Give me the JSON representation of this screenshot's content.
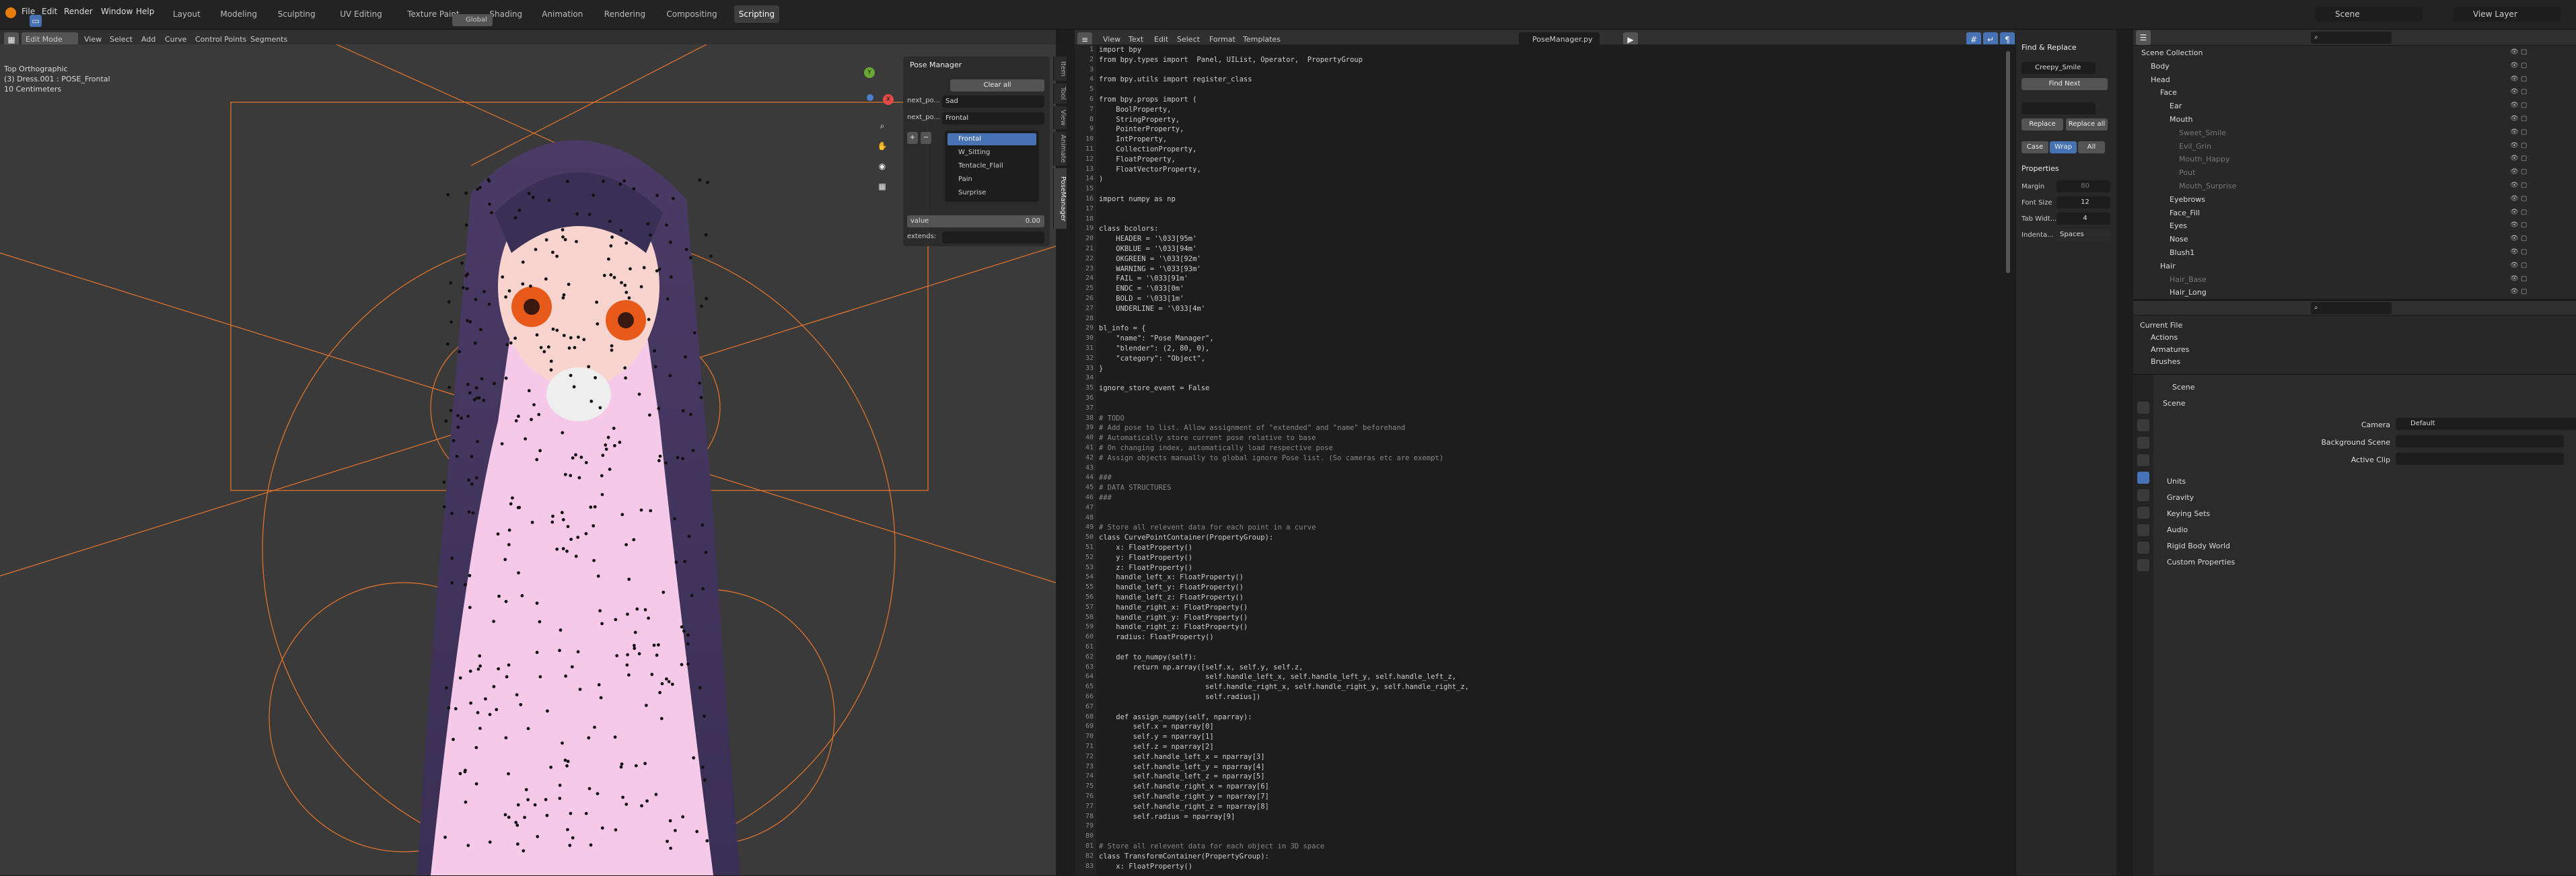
{
  "menu": {
    "file": "File",
    "edit": "Edit",
    "render": "Render",
    "window": "Window",
    "help": "Help"
  },
  "workspaces": [
    "Layout",
    "Modeling",
    "Sculpting",
    "UV Editing",
    "Texture Paint",
    "Shading",
    "Animation",
    "Rendering",
    "Compositing",
    "Scripting"
  ],
  "active_workspace": "Scripting",
  "scene": {
    "name": "Scene",
    "view_layer": "View Layer"
  },
  "viewport": {
    "header": {
      "mode": "Edit Mode",
      "view": "View",
      "select": "Select",
      "add": "Add",
      "curve": "Curve",
      "control_points": "Control Points",
      "segments": "Segments",
      "orientation": "Global"
    },
    "info_line1": "Top Orthographic",
    "info_line2": "(3) Dress.001 : POSE_Frontal",
    "info_line3": "10 Centimeters",
    "gizmo": {
      "x": "X",
      "y": "Y",
      "z": "Z"
    }
  },
  "pose_panel": {
    "title": "Pose Manager",
    "clear_all": "Clear all",
    "next_pose_label": "next_po...",
    "next_pose_value": "Sad",
    "next_pose2_label": "next_po...",
    "next_pose2_value": "Frontal",
    "poses": [
      "Frontal",
      "W_Sitting",
      "Tentacle_Flail",
      "Pain",
      "Surprise"
    ],
    "value_label": "value",
    "value": "0.00",
    "extends_label": "extends:"
  },
  "side_tabs": [
    "Item",
    "Tool",
    "View",
    "Animate",
    "PoseManager"
  ],
  "text_editor": {
    "menus": {
      "view": "View",
      "text": "Text",
      "edit": "Edit",
      "select": "Select",
      "format": "Format",
      "templates": "Templates"
    },
    "filename": "PoseManager.py",
    "lines": [
      {
        "n": "1",
        "t": "import bpy"
      },
      {
        "n": "2",
        "t": "from bpy.types import  Panel, UIList, Operator,  PropertyGroup"
      },
      {
        "n": "3",
        "t": ""
      },
      {
        "n": "4",
        "t": "from bpy.utils import register_class"
      },
      {
        "n": "5",
        "t": ""
      },
      {
        "n": "6",
        "t": "from bpy.props import ("
      },
      {
        "n": "7",
        "t": "    BoolProperty,"
      },
      {
        "n": "8",
        "t": "    StringProperty,"
      },
      {
        "n": "9",
        "t": "    PointerProperty,"
      },
      {
        "n": "10",
        "t": "    IntProperty,"
      },
      {
        "n": "11",
        "t": "    CollectionProperty,"
      },
      {
        "n": "12",
        "t": "    FloatProperty,"
      },
      {
        "n": "13",
        "t": "    FloatVectorProperty,"
      },
      {
        "n": "14",
        "t": ")"
      },
      {
        "n": "15",
        "t": ""
      },
      {
        "n": "16",
        "t": "import numpy as np"
      },
      {
        "n": "17",
        "t": ""
      },
      {
        "n": "18",
        "t": ""
      },
      {
        "n": "19",
        "t": "class bcolors:"
      },
      {
        "n": "20",
        "t": "    HEADER = '\\033[95m'"
      },
      {
        "n": "21",
        "t": "    OKBLUE = '\\033[94m'"
      },
      {
        "n": "22",
        "t": "    OKGREEN = '\\033[92m'"
      },
      {
        "n": "23",
        "t": "    WARNING = '\\033[93m'"
      },
      {
        "n": "24",
        "t": "    FAIL = '\\033[91m'"
      },
      {
        "n": "25",
        "t": "    ENDC = '\\033[0m'"
      },
      {
        "n": "26",
        "t": "    BOLD = '\\033[1m'"
      },
      {
        "n": "27",
        "t": "    UNDERLINE = '\\033[4m'"
      },
      {
        "n": "28",
        "t": ""
      },
      {
        "n": "29",
        "t": "bl_info = {"
      },
      {
        "n": "30",
        "t": "    \"name\": \"Pose Manager\","
      },
      {
        "n": "31",
        "t": "    \"blender\": (2, 80, 0),"
      },
      {
        "n": "32",
        "t": "    \"category\": \"Object\","
      },
      {
        "n": "33",
        "t": "}"
      },
      {
        "n": "34",
        "t": ""
      },
      {
        "n": "35",
        "t": "ignore_store_event = False"
      },
      {
        "n": "36",
        "t": ""
      },
      {
        "n": "37",
        "t": ""
      },
      {
        "n": "38",
        "t": "# TODO"
      },
      {
        "n": "39",
        "t": "# Add pose to list. Allow assignment of \"extended\" and \"name\" beforehand"
      },
      {
        "n": "40",
        "t": "# Automatically store current pose relative to base"
      },
      {
        "n": "41",
        "t": "# On changing index, automatically load respective pose"
      },
      {
        "n": "42",
        "t": "# Assign objects manually to global ignore Pose list. (So cameras etc are exempt)"
      },
      {
        "n": "43",
        "t": ""
      },
      {
        "n": "44",
        "t": "###"
      },
      {
        "n": "45",
        "t": "# DATA STRUCTURES"
      },
      {
        "n": "46",
        "t": "###"
      },
      {
        "n": "47",
        "t": ""
      },
      {
        "n": "48",
        "t": ""
      },
      {
        "n": "49",
        "t": "# Store all relevent data for each point in a curve"
      },
      {
        "n": "50",
        "t": "class CurvePointContainer(PropertyGroup):"
      },
      {
        "n": "51",
        "t": "    x: FloatProperty()"
      },
      {
        "n": "52",
        "t": "    y: FloatProperty()"
      },
      {
        "n": "53",
        "t": "    z: FloatProperty()"
      },
      {
        "n": "54",
        "t": "    handle_left_x: FloatProperty()"
      },
      {
        "n": "55",
        "t": "    handle_left_y: FloatProperty()"
      },
      {
        "n": "56",
        "t": "    handle_left_z: FloatProperty()"
      },
      {
        "n": "57",
        "t": "    handle_right_x: FloatProperty()"
      },
      {
        "n": "58",
        "t": "    handle_right_y: FloatProperty()"
      },
      {
        "n": "59",
        "t": "    handle_right_z: FloatProperty()"
      },
      {
        "n": "60",
        "t": "    radius: FloatProperty()"
      },
      {
        "n": "61",
        "t": ""
      },
      {
        "n": "62",
        "t": "    def to_numpy(self):"
      },
      {
        "n": "63",
        "t": "        return np.array([self.x, self.y, self.z,"
      },
      {
        "n": "64",
        "t": "                         self.handle_left_x, self.handle_left_y, self.handle_left_z,"
      },
      {
        "n": "65",
        "t": "                         self.handle_right_x, self.handle_right_y, self.handle_right_z,"
      },
      {
        "n": "66",
        "t": "                         self.radius])"
      },
      {
        "n": "67",
        "t": ""
      },
      {
        "n": "68",
        "t": "    def assign_numpy(self, nparray):"
      },
      {
        "n": "69",
        "t": "        self.x = nparray[0]"
      },
      {
        "n": "70",
        "t": "        self.y = nparray[1]"
      },
      {
        "n": "71",
        "t": "        self.z = nparray[2]"
      },
      {
        "n": "72",
        "t": "        self.handle_left_x = nparray[3]"
      },
      {
        "n": "73",
        "t": "        self.handle_left_y = nparray[4]"
      },
      {
        "n": "74",
        "t": "        self.handle_left_z = nparray[5]"
      },
      {
        "n": "75",
        "t": "        self.handle_right_x = nparray[6]"
      },
      {
        "n": "76",
        "t": "        self.handle_right_y = nparray[7]"
      },
      {
        "n": "77",
        "t": "        self.handle_right_z = nparray[8]"
      },
      {
        "n": "78",
        "t": "        self.radius = nparray[9]"
      },
      {
        "n": "79",
        "t": ""
      },
      {
        "n": "80",
        "t": ""
      },
      {
        "n": "81",
        "t": "# Store all relevent data for each object in 3D space"
      },
      {
        "n": "82",
        "t": "class TransformContainer(PropertyGroup):"
      },
      {
        "n": "83",
        "t": "    x: FloatProperty()"
      }
    ]
  },
  "find_replace": {
    "title": "Find & Replace",
    "find_value": "Creepy_Smile",
    "find_next": "Find Next",
    "replace_value": "",
    "replace": "Replace",
    "replace_all": "Replace all",
    "case": "Case",
    "wrap": "Wrap",
    "all": "All",
    "properties_title": "Properties",
    "margin_label": "Margin",
    "margin_value": "80",
    "font_size_label": "Font Size",
    "font_size_value": "12",
    "tab_width_label": "Tab Widt...",
    "tab_width_value": "4",
    "indent_label": "Indenta...",
    "indent_value": "Spaces"
  },
  "outliner": {
    "items": [
      {
        "label": "Scene Collection",
        "indent": 0,
        "dim": false
      },
      {
        "label": "Body",
        "indent": 1,
        "dim": false
      },
      {
        "label": "Head",
        "indent": 1,
        "dim": false
      },
      {
        "label": "Face",
        "indent": 2,
        "dim": false
      },
      {
        "label": "Ear",
        "indent": 3,
        "dim": false
      },
      {
        "label": "Mouth",
        "indent": 3,
        "dim": false
      },
      {
        "label": "Sweet_Smile",
        "indent": 4,
        "dim": true
      },
      {
        "label": "Evil_Grin",
        "indent": 4,
        "dim": true
      },
      {
        "label": "Mouth_Happy",
        "indent": 4,
        "dim": true
      },
      {
        "label": "Pout",
        "indent": 4,
        "dim": true
      },
      {
        "label": "Mouth_Surprise",
        "indent": 4,
        "dim": true
      },
      {
        "label": "Eyebrows",
        "indent": 3,
        "dim": false
      },
      {
        "label": "Face_Fill",
        "indent": 3,
        "dim": false
      },
      {
        "label": "Eyes",
        "indent": 3,
        "dim": false
      },
      {
        "label": "Nose",
        "indent": 3,
        "dim": false
      },
      {
        "label": "Blush1",
        "indent": 3,
        "dim": false
      },
      {
        "label": "Hair",
        "indent": 2,
        "dim": false
      },
      {
        "label": "Hair_Base",
        "indent": 3,
        "dim": true
      },
      {
        "label": "Hair_Long",
        "indent": 3,
        "dim": false
      }
    ]
  },
  "file_view": {
    "current_file": "Current File",
    "actions": "Actions",
    "armatures": "Armatures",
    "brushes": "Brushes"
  },
  "properties": {
    "scene_name": "Scene",
    "section": "Scene",
    "camera_label": "Camera",
    "camera_value": "Default",
    "background_label": "Background Scene",
    "active_clip_label": "Active Clip",
    "units": "Units",
    "gravity": "Gravity",
    "keying_sets": "Keying Sets",
    "audio": "Audio",
    "rigid_body": "Rigid Body World",
    "custom_props": "Custom Properties"
  },
  "colors": {
    "accent": "#4772b3",
    "curve": "#e8762b",
    "bg_dark": "#1d1d1d"
  }
}
